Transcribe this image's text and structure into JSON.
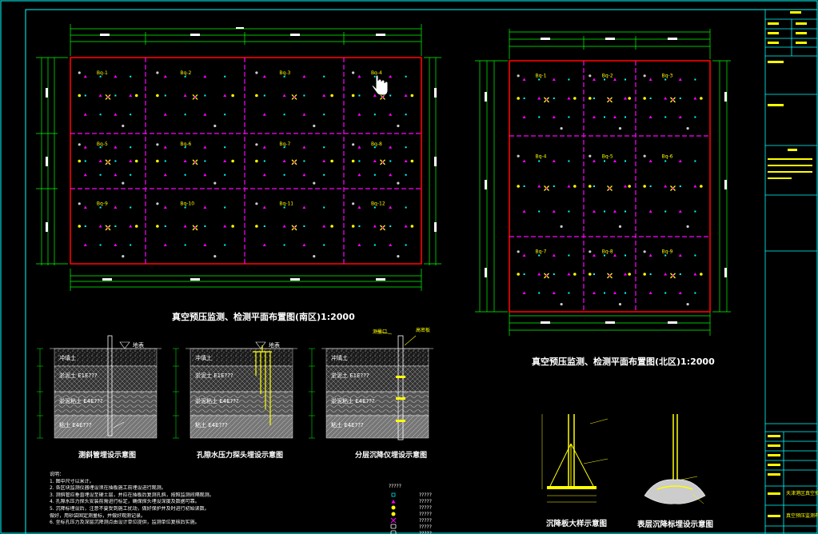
{
  "south_plan": {
    "title": "真空预压监测、检测平面布置图(南区)1:2000",
    "zone_labels": [
      "Bq-1",
      "Bq-2",
      "Bq-3",
      "Bq-4",
      "Bq-5",
      "Bq-6",
      "Bq-7",
      "Bq-8",
      "Bq-9",
      "Bq-10",
      "Bq-11",
      "Bq-12"
    ]
  },
  "north_plan": {
    "title": "真空预压监测、检测平面布置图(北区)1:2000",
    "zone_labels": [
      "Bq-1",
      "Bq-2",
      "Bq-3",
      "Bq-4",
      "Bq-5",
      "Bq-6",
      "Bq-7",
      "Bq-8",
      "Bq-9"
    ]
  },
  "sections": [
    {
      "title": "测斜管埋设示意图",
      "layers": [
        "冲填土",
        "淤泥土 E1E???",
        "淤泥粘土 E4E???",
        "粘土 E4E???"
      ],
      "top_label": "地表"
    },
    {
      "title": "孔隙水压力探头埋设示意图",
      "layers": [
        "冲填土",
        "淤泥土 E1E???",
        "淤泥粘土 E4E???",
        "粘土 E4E???"
      ],
      "top_label": "地表"
    },
    {
      "title": "分层沉降仪埋设示意图",
      "layers": [
        "冲填土",
        "淤泥土 E1E???",
        "淤泥粘土 E4E???",
        "粘土 E4E???"
      ],
      "top_labels": [
        "测量口",
        "高密板"
      ]
    }
  ],
  "details": [
    {
      "title": "沉降板大样示意图"
    },
    {
      "title": "表层沉降标埋设示意图"
    }
  ],
  "notes": {
    "heading": "说明：",
    "lines": [
      "1. 图中尺寸以米计。",
      "2. 各区块监测仪器埋设须在插板施工前埋设进行观测。",
      "3. 测斜管应垂直埋设至硬土层，并应在插板后复测孔斜，按照监测间隔观测。",
      "4. 孔隙水压力探头安装前需进行标定，确保探头埋设深度及数据可靠。",
      "5. 沉降标埋设后，注意不要受到施工扰动，做好保护并及时进行初始读数。",
      "   做好，用砂袋固定测量标，并做好观测记录。",
      "6. 坐标孔压力及深层沉降测点由设计单位提供，监测单位复核后实施。"
    ]
  },
  "legend": {
    "header": "?????",
    "items": [
      "?????",
      "?????",
      "?????",
      "?????",
      "?????",
      "?????",
      "?????"
    ],
    "colors": [
      "#00ffff",
      "#ff00ff",
      "#ffff00",
      "#ffff00",
      "#ff00ff",
      "#ffffff",
      "#ffffff"
    ]
  },
  "title_block": {
    "project": "天津港区真空预压工程",
    "drawing": "真空预压监测布置图",
    "labels": [
      "工程名称",
      "工程编号",
      "图号",
      "日期"
    ]
  },
  "colors": {
    "boundary": "#ff0000",
    "grid": "#ff00ff",
    "dimension": "#00ff00",
    "frame": "#00ffff",
    "text": "#ffffff",
    "marker": "#ffff00"
  }
}
